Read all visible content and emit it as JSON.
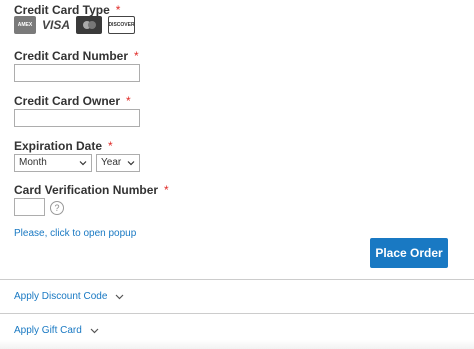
{
  "payment": {
    "card_type_label": "Credit Card Type",
    "required_mark": "*",
    "card_types": [
      {
        "name": "amex",
        "text": "AMEX"
      },
      {
        "name": "visa",
        "text": "VISA"
      },
      {
        "name": "mastercard",
        "text": ""
      },
      {
        "name": "discover",
        "text": "DISCOVER"
      }
    ],
    "card_number_label": "Credit Card Number",
    "card_number_value": "",
    "card_owner_label": "Credit Card Owner",
    "card_owner_value": "",
    "expiration_label": "Expiration Date",
    "month_selected": "Month",
    "year_selected": "Year",
    "cvv_label": "Card Verification Number",
    "cvv_value": "",
    "help_text": "?",
    "popup_link": "Please, click to open popup",
    "place_order": "Place Order"
  },
  "sections": {
    "discount": "Apply Discount Code",
    "gift_card": "Apply Gift Card"
  },
  "colors": {
    "accent": "#1979c3",
    "required": "#e02b27"
  }
}
